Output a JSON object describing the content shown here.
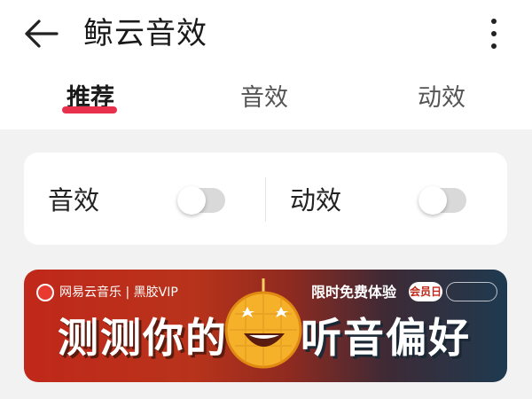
{
  "header": {
    "title": "鲸云音效",
    "back_icon": "arrow-left-icon",
    "more_icon": "more-vertical-icon"
  },
  "tabs": [
    {
      "label": "推荐",
      "active": true
    },
    {
      "label": "音效",
      "active": false
    },
    {
      "label": "动效",
      "active": false
    }
  ],
  "toggles_card": {
    "items": [
      {
        "label": "音效",
        "on": false
      },
      {
        "label": "动效",
        "on": false
      }
    ]
  },
  "banner": {
    "brand": "网易云音乐 | 黑胶VIP",
    "offer": "限时免费体验",
    "badge": "会员日",
    "headline_left": "测测你的",
    "headline_right": "听音偏好"
  },
  "colors": {
    "accent": "#e8304d",
    "background": "#f2f2f2",
    "toggle_off": "#d9d9d9"
  }
}
